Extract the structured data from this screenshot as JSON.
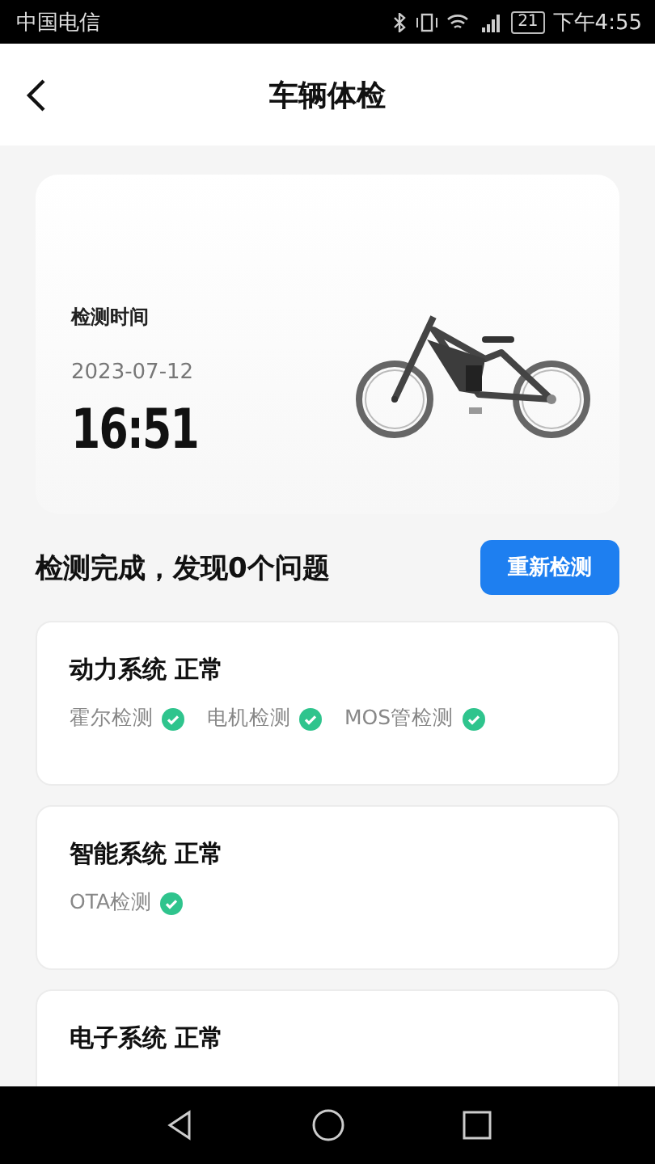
{
  "status_bar": {
    "carrier": "中国电信",
    "battery": "21",
    "time": "下午4:55"
  },
  "header": {
    "title": "车辆体检"
  },
  "hero": {
    "label": "检测时间",
    "date": "2023-07-12",
    "time": "16:51",
    "kind": "picture"
  },
  "summary": {
    "text": "检测完成，发现0个问题",
    "button": "重新检测"
  },
  "systems": [
    {
      "title": "动力系统 正常",
      "checks": [
        {
          "label": "霍尔检测",
          "passed": true
        },
        {
          "label": "电机检测",
          "passed": true
        },
        {
          "label": "MOS管检测",
          "passed": true
        }
      ]
    },
    {
      "title": "智能系统 正常",
      "checks": [
        {
          "label": "OTA检测",
          "passed": true
        }
      ]
    },
    {
      "title": "电子系统 正常"
    }
  ]
}
